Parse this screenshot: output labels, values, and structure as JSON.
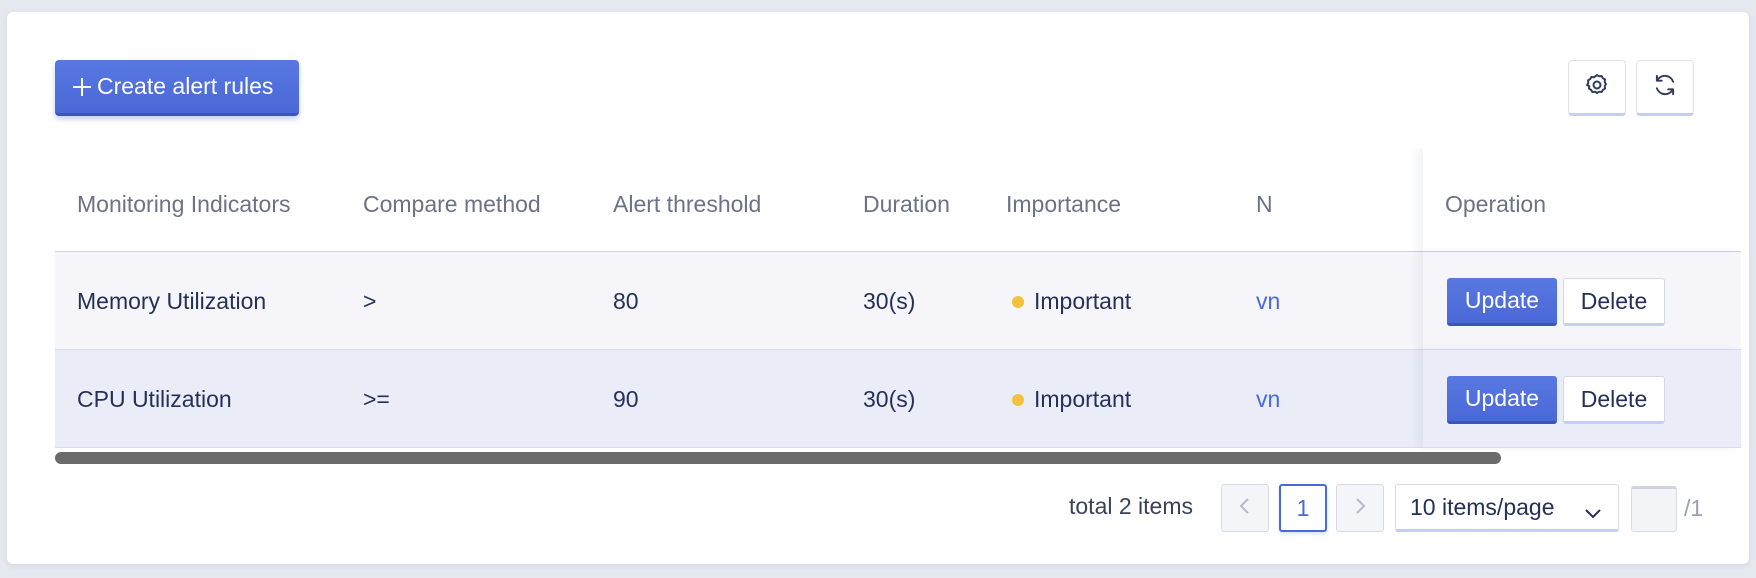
{
  "toolbar": {
    "create_label": "Create alert rules",
    "create_icon": "plus-icon",
    "settings_icon": "gear-icon",
    "refresh_icon": "refresh-icon"
  },
  "table": {
    "columns": [
      "Monitoring Indicators",
      "Compare method",
      "Alert threshold",
      "Duration",
      "Importance",
      "N",
      "Operation"
    ],
    "rows": [
      {
        "indicator": "Memory Utilization",
        "compare": ">",
        "threshold": "80",
        "duration": "30(s)",
        "importance": "Important",
        "notify": "vn"
      },
      {
        "indicator": "CPU Utilization",
        "compare": ">=",
        "threshold": "90",
        "duration": "30(s)",
        "importance": "Important",
        "notify": "vn"
      }
    ],
    "update_label": "Update",
    "delete_label": "Delete"
  },
  "colors": {
    "primary": "#4a68d8",
    "importance_dot": "#f2c33a",
    "link": "#4a6ad8"
  },
  "pagination": {
    "total_text": "total 2 items",
    "current_page": "1",
    "page_size": "10 items/page",
    "total_pages": "/1"
  }
}
